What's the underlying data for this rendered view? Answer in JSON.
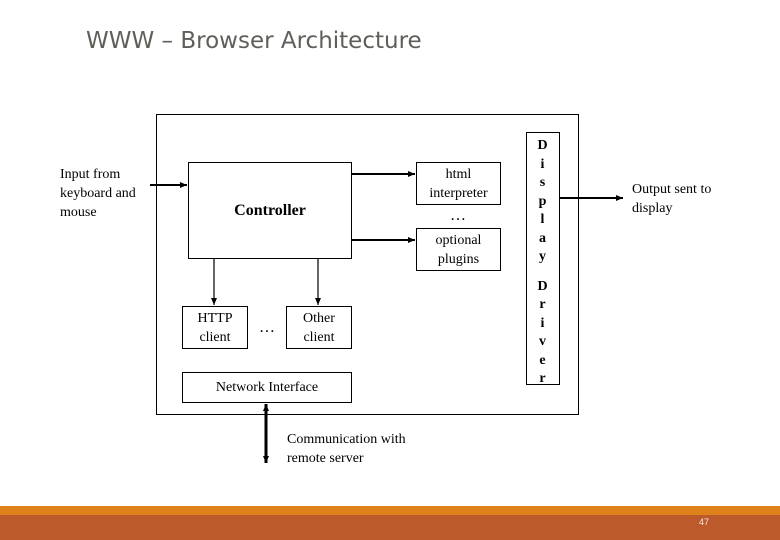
{
  "slide": {
    "title": "WWW – Browser Architecture",
    "page_number": "47"
  },
  "diagram": {
    "input_label": "Input from keyboard and mouse",
    "input_lines": [
      "Input from",
      "keyboard and",
      "mouse"
    ],
    "controller": "Controller",
    "html_interpreter": [
      "html",
      "interpreter"
    ],
    "interpreter_ellipsis": "…",
    "optional_plugins": [
      "optional",
      "plugins"
    ],
    "http_client": [
      "HTTP",
      "client"
    ],
    "clients_ellipsis": "…",
    "other_client": [
      "Other",
      "client"
    ],
    "network_interface": "Network Interface",
    "display_driver_letters": [
      "D",
      "i",
      "s",
      "p",
      "l",
      "a",
      "y",
      "",
      "D",
      "r",
      "i",
      "v",
      "e",
      "r"
    ],
    "output_lines": [
      "Output sent to",
      "display"
    ],
    "communication_lines": [
      "Communication with",
      "remote server"
    ]
  },
  "colors": {
    "footer_band": "#bd5a2c",
    "footer_accent": "#e0821b",
    "title_text": "#5f5f5a"
  }
}
